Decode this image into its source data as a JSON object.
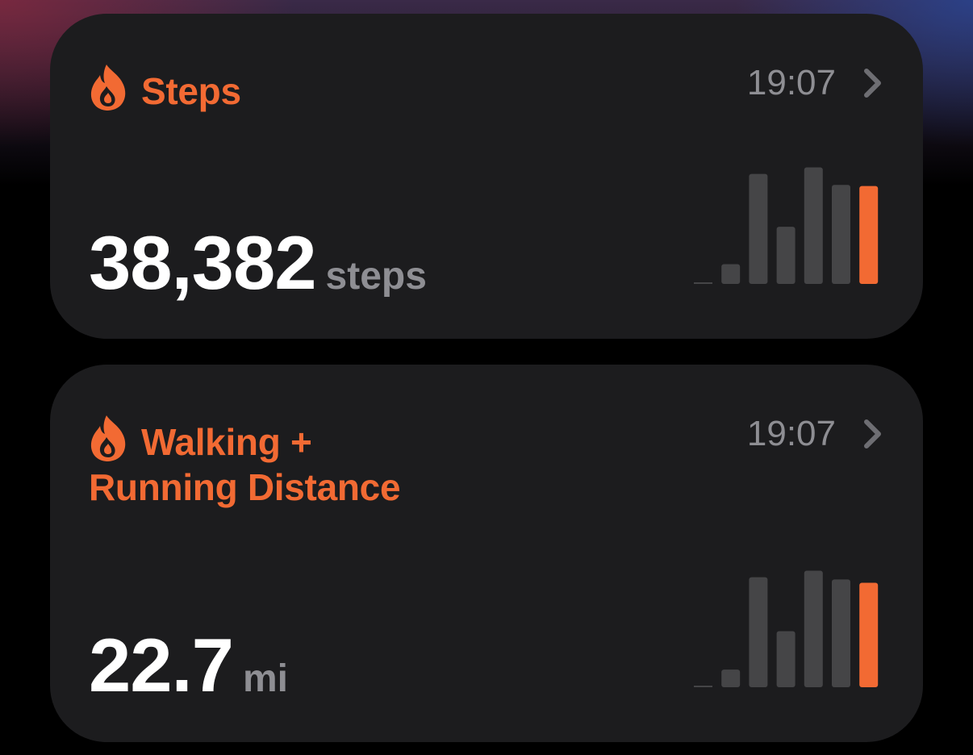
{
  "colors": {
    "accent": "#f26a33",
    "bar_inactive": "#454547",
    "card_bg": "#1c1c1e",
    "secondary_text": "#8e8e93"
  },
  "cards": [
    {
      "icon": "flame-icon",
      "title_line1": "Steps",
      "title_line2": "",
      "time": "19:07",
      "value": "38,382",
      "unit": "steps",
      "chart_data": {
        "type": "bar",
        "series": [
          {
            "values": [
              0.01,
              0.18,
              1.0,
              0.52,
              1.06,
              0.9,
              0.89
            ]
          }
        ],
        "highlight_last": true,
        "ylim": [
          0,
          1.1
        ]
      }
    },
    {
      "icon": "flame-icon",
      "title_line1": "Walking +",
      "title_line2": "Running Distance",
      "time": "19:07",
      "value": "22.7",
      "unit": "mi",
      "chart_data": {
        "type": "bar",
        "series": [
          {
            "values": [
              0.01,
              0.16,
              1.0,
              0.51,
              1.06,
              0.98,
              0.95
            ]
          }
        ],
        "highlight_last": true,
        "ylim": [
          0,
          1.1
        ]
      }
    }
  ]
}
